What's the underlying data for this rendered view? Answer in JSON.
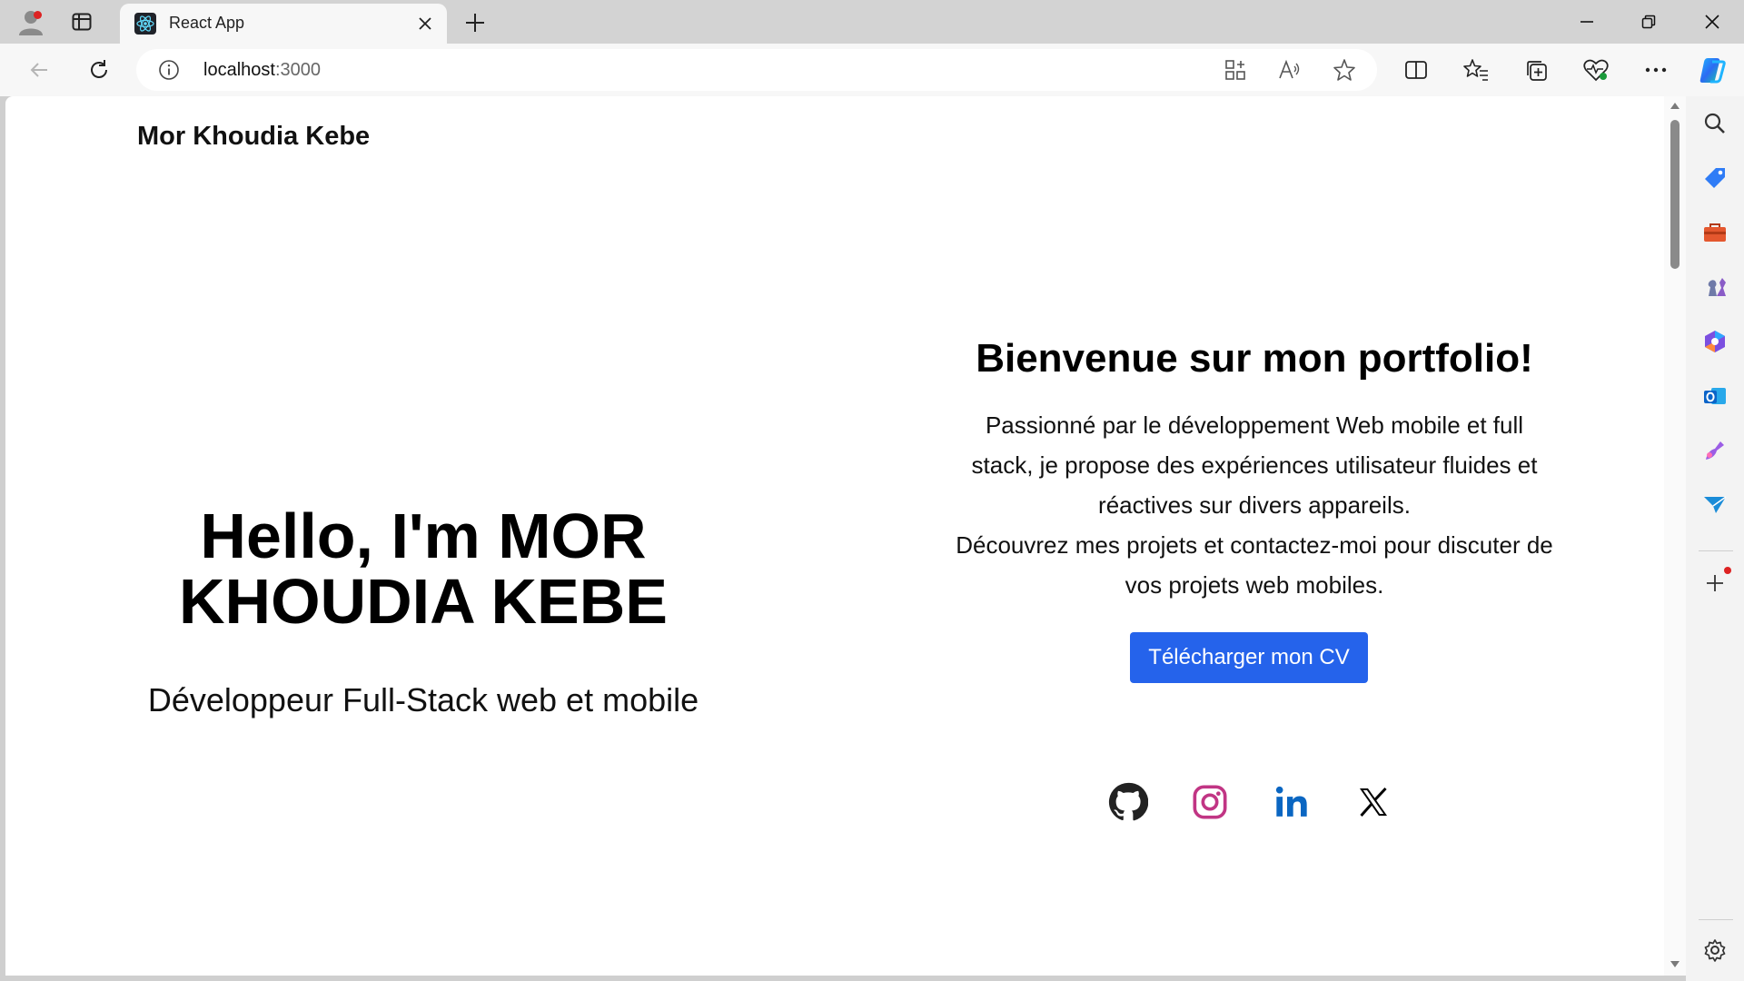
{
  "browser": {
    "tab_title": "React App",
    "url_host": "localhost",
    "url_port": ":3000"
  },
  "page": {
    "brand": "Mor Khoudia Kebe",
    "hero": {
      "title_line1": "Hello, I'm MOR",
      "title_line2": "KHOUDIA KEBE",
      "subtitle": "Développeur Full-Stack web et mobile"
    },
    "welcome": {
      "heading": "Bienvenue sur mon portfolio!",
      "paragraph1": "Passionné par le développement Web mobile et full stack, je propose des expériences utilisateur fluides et réactives sur divers appareils.",
      "paragraph2": "Découvrez mes projets et contactez-moi pour discuter de vos projets web mobiles.",
      "cv_button": "Télécharger mon CV"
    },
    "social_links": [
      {
        "name": "github-icon",
        "color": "#222222"
      },
      {
        "name": "instagram-icon",
        "color": "#c13584"
      },
      {
        "name": "linkedin-icon",
        "color": "#0a66c2"
      },
      {
        "name": "x-icon",
        "color": "#000000"
      }
    ]
  },
  "colors": {
    "accent": "#2563eb",
    "chrome_bg": "#d3d3d3",
    "toolbar_bg": "#f7f7f7"
  }
}
